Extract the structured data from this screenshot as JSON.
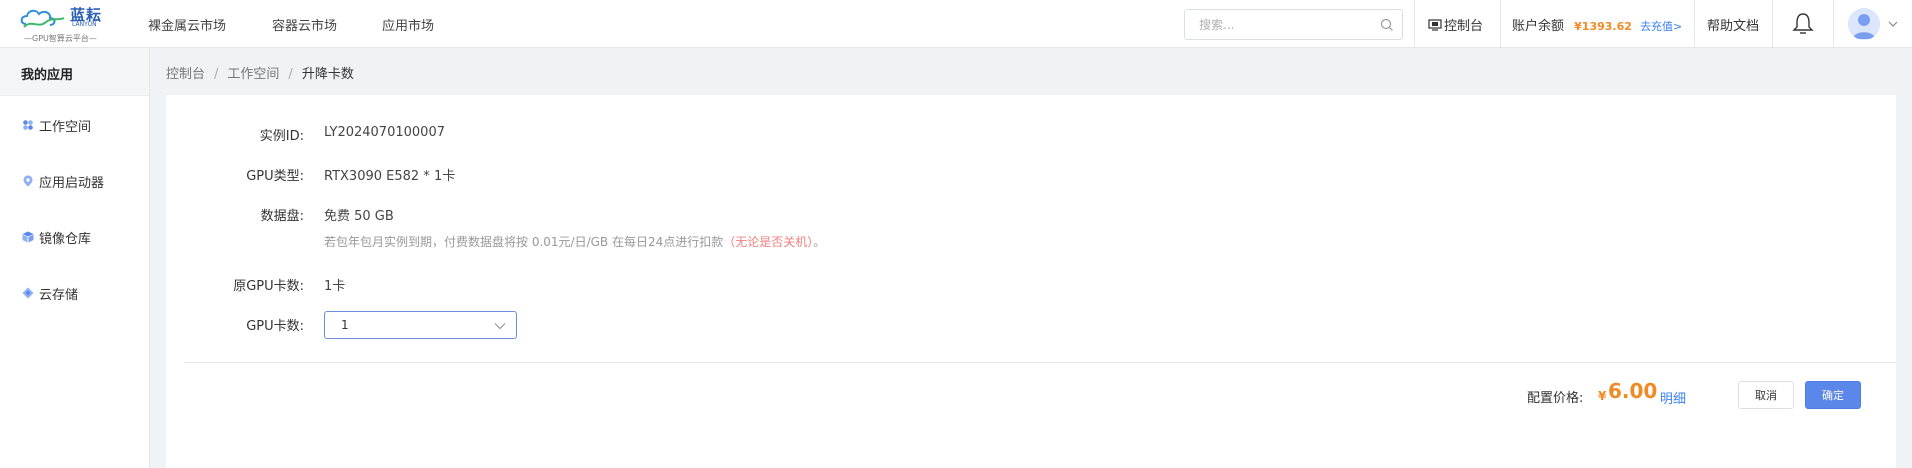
{
  "header": {
    "logo": {
      "title": "蓝耘",
      "subtitle_en": "LANYUN",
      "subtitle": "—GPU智算云平台—"
    },
    "nav": [
      "裸金属云市场",
      "容器云市场",
      "应用市场"
    ],
    "search": {
      "placeholder": "搜索...",
      "value": ""
    },
    "console_label": "控制台",
    "balance_label": "账户余额",
    "balance_value": "¥1393.62",
    "recharge_label": "去充值>",
    "help_label": "帮助文档"
  },
  "sidebar": {
    "title": "我的应用",
    "items": [
      {
        "label": "工作空间",
        "icon": "workspace-icon"
      },
      {
        "label": "应用启动器",
        "icon": "app-launcher-icon"
      },
      {
        "label": "镜像仓库",
        "icon": "image-repo-icon"
      },
      {
        "label": "云存储",
        "icon": "cloud-storage-icon"
      }
    ]
  },
  "breadcrumb": [
    "控制台",
    "工作空间",
    "升降卡数"
  ],
  "form": {
    "instance_id": {
      "label": "实例ID:",
      "value": "LY2024070100007"
    },
    "gpu_type": {
      "label": "GPU类型:",
      "value": "RTX3090 E582 * 1卡"
    },
    "data_disk": {
      "label": "数据盘:",
      "value": "免费 50 GB"
    },
    "note": {
      "text": "若包年包月实例到期，付费数据盘将按 0.01元/日/GB 在每日24点进行扣款",
      "warning": "（无论是否关机）",
      "end": "。"
    },
    "orig_gpu": {
      "label": "原GPU卡数:",
      "value": "1卡"
    },
    "gpu_count": {
      "label": "GPU卡数:",
      "value": "1"
    }
  },
  "footer": {
    "price_label": "配置价格:",
    "currency": "¥",
    "price": "6.00",
    "detail_label": "明细",
    "cancel_label": "取消",
    "ok_label": "确定"
  },
  "colors": {
    "accent": "#5b86ea",
    "price": "#f08a24",
    "link": "#3b82f6",
    "warning": "#f08080"
  }
}
